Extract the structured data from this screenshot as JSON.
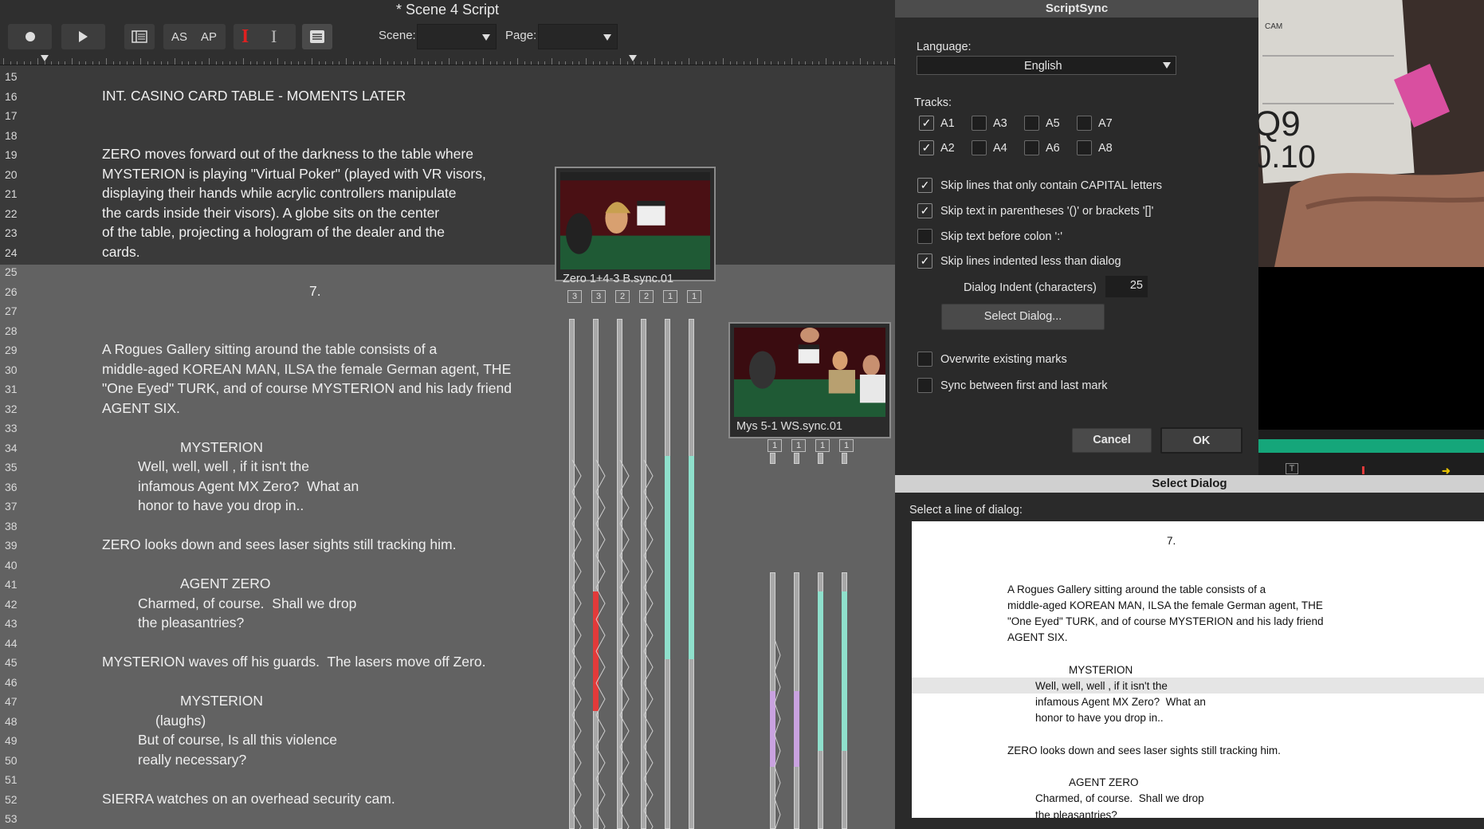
{
  "window": {
    "title": "* Scene 4 Script"
  },
  "toolbar": {
    "record_icon": "record-icon",
    "play_icon": "play-icon",
    "as_label": "AS",
    "ap_label": "AP",
    "scene_label": "Scene:",
    "scene_value": "",
    "page_label": "Page:",
    "page_value": ""
  },
  "script_lines": [
    {
      "n": "15",
      "text": "",
      "indent": 0
    },
    {
      "n": "16",
      "text": "INT. CASINO CARD TABLE - MOMENTS LATER",
      "indent": 0
    },
    {
      "n": "17",
      "text": "",
      "indent": 0
    },
    {
      "n": "18",
      "text": "",
      "indent": 0
    },
    {
      "n": "19",
      "text": "ZERO moves forward out of the darkness to the table where",
      "indent": 0
    },
    {
      "n": "20",
      "text": "MYSTERION is playing \"Virtual Poker\" (played with VR visors,",
      "indent": 0
    },
    {
      "n": "21",
      "text": "displaying their hands while acrylic controllers manipulate",
      "indent": 0
    },
    {
      "n": "22",
      "text": "the cards inside their visors). A globe sits on the center",
      "indent": 0
    },
    {
      "n": "23",
      "text": "of the table, projecting a hologram of the dealer and the",
      "indent": 0
    },
    {
      "n": "24",
      "text": "cards.",
      "indent": 0
    },
    {
      "n": "25",
      "text": "",
      "indent": 0
    },
    {
      "n": "26",
      "text": "7.",
      "indent": 3
    },
    {
      "n": "27",
      "text": "",
      "indent": 0
    },
    {
      "n": "28",
      "text": "",
      "indent": 0
    },
    {
      "n": "29",
      "text": "A Rogues Gallery sitting around the table consists of a",
      "indent": 0
    },
    {
      "n": "30",
      "text": "middle-aged KOREAN MAN, ILSA the female German agent, THE",
      "indent": 0
    },
    {
      "n": "31",
      "text": "\"One Eyed\" TURK, and of course MYSTERION and his lady friend",
      "indent": 0
    },
    {
      "n": "32",
      "text": "AGENT SIX.",
      "indent": 0
    },
    {
      "n": "33",
      "text": "",
      "indent": 0
    },
    {
      "n": "34",
      "text": "MYSTERION",
      "indent": 2
    },
    {
      "n": "35",
      "text": "Well, well, well , if it isn't the",
      "indent": 1
    },
    {
      "n": "36",
      "text": "infamous Agent MX Zero?  What an",
      "indent": 1
    },
    {
      "n": "37",
      "text": "honor to have you drop in..",
      "indent": 1
    },
    {
      "n": "38",
      "text": "",
      "indent": 0
    },
    {
      "n": "39",
      "text": "ZERO looks down and sees laser sights still tracking him.",
      "indent": 0
    },
    {
      "n": "40",
      "text": "",
      "indent": 0
    },
    {
      "n": "41",
      "text": "AGENT ZERO",
      "indent": 2
    },
    {
      "n": "42",
      "text": "Charmed, of course.  Shall we drop",
      "indent": 1
    },
    {
      "n": "43",
      "text": "the pleasantries?",
      "indent": 1
    },
    {
      "n": "44",
      "text": "",
      "indent": 0
    },
    {
      "n": "45",
      "text": "MYSTERION waves off his guards.  The lasers move off Zero.",
      "indent": 0
    },
    {
      "n": "46",
      "text": "",
      "indent": 0
    },
    {
      "n": "47",
      "text": "MYSTERION",
      "indent": 2
    },
    {
      "n": "48",
      "text": "(laughs)",
      "indent": 4
    },
    {
      "n": "49",
      "text": "But of course, Is all this violence",
      "indent": 1
    },
    {
      "n": "50",
      "text": "really necessary?",
      "indent": 1
    },
    {
      "n": "51",
      "text": "",
      "indent": 0
    },
    {
      "n": "52",
      "text": "SIERRA watches on an overhead security cam.",
      "indent": 0
    },
    {
      "n": "53",
      "text": "",
      "indent": 0
    }
  ],
  "clips": [
    {
      "name": "Zero 1+4-3 B.sync.01",
      "chips": [
        "3",
        "3",
        "2",
        "2",
        "1",
        "1"
      ]
    },
    {
      "name": "Mys 5-1 WS.sync.01",
      "chips": [
        "1",
        "1",
        "1",
        "1"
      ]
    }
  ],
  "scriptsync": {
    "title": "ScriptSync",
    "language_label": "Language:",
    "language_value": "English",
    "tracks_label": "Tracks:",
    "tracks": [
      {
        "label": "A1",
        "checked": true
      },
      {
        "label": "A3",
        "checked": false
      },
      {
        "label": "A5",
        "checked": false
      },
      {
        "label": "A7",
        "checked": false
      },
      {
        "label": "A2",
        "checked": true
      },
      {
        "label": "A4",
        "checked": false
      },
      {
        "label": "A6",
        "checked": false
      },
      {
        "label": "A8",
        "checked": false
      }
    ],
    "options": [
      {
        "label": "Skip lines that only contain CAPITAL letters",
        "checked": true
      },
      {
        "label": "Skip text in parentheses '()' or brackets '[]'",
        "checked": true
      },
      {
        "label": "Skip text before colon ':'",
        "checked": false
      },
      {
        "label": "Skip lines indented less than dialog",
        "checked": true
      }
    ],
    "dialog_indent_label": "Dialog Indent (characters)",
    "dialog_indent_value": "25",
    "select_dialog_button": "Select Dialog...",
    "overwrite_label": "Overwrite existing marks",
    "overwrite_checked": false,
    "sync_label": "Sync between first and last mark",
    "sync_checked": false,
    "cancel_label": "Cancel",
    "ok_label": "OK"
  },
  "select_dialog": {
    "title": "Select Dialog",
    "prompt": "Select a line of dialog:",
    "lines": [
      {
        "text": "",
        "indent": 0
      },
      {
        "text": "7.",
        "indent": 3
      },
      {
        "text": "",
        "indent": 0
      },
      {
        "text": "",
        "indent": 0
      },
      {
        "text": "A Rogues Gallery sitting around the table consists of a",
        "indent": 0
      },
      {
        "text": "middle-aged KOREAN MAN, ILSA the female German agent, THE",
        "indent": 0
      },
      {
        "text": "\"One Eyed\" TURK, and of course MYSTERION and his lady friend",
        "indent": 0
      },
      {
        "text": "AGENT SIX.",
        "indent": 0
      },
      {
        "text": "",
        "indent": 0
      },
      {
        "text": "MYSTERION",
        "indent": 2
      },
      {
        "text": "Well, well, well , if it isn't the",
        "indent": 1
      },
      {
        "text": "infamous Agent MX Zero?  What an",
        "indent": 1
      },
      {
        "text": "honor to have you drop in..",
        "indent": 1
      },
      {
        "text": "",
        "indent": 0
      },
      {
        "text": "ZERO looks down and sees laser sights still tracking him.",
        "indent": 0
      },
      {
        "text": "",
        "indent": 0
      },
      {
        "text": "AGENT ZERO",
        "indent": 2
      },
      {
        "text": "Charmed, of course.  Shall we drop",
        "indent": 1
      },
      {
        "text": "the pleasantries?",
        "indent": 1
      }
    ],
    "highlighted_line": 10
  },
  "colors": {
    "accent_teal": "#8fe0cc",
    "mark_red": "#e23a3a",
    "mark_purple": "#c9a2e0",
    "insertion_tool": "#e02020",
    "timeline_green": "#15a67a"
  },
  "icons": [
    "record-icon",
    "play-icon",
    "script-view-icon",
    "insertion-tool-icon",
    "split-tool-icon",
    "list-icon",
    "chevron-down-icon",
    "checkmark-icon"
  ]
}
